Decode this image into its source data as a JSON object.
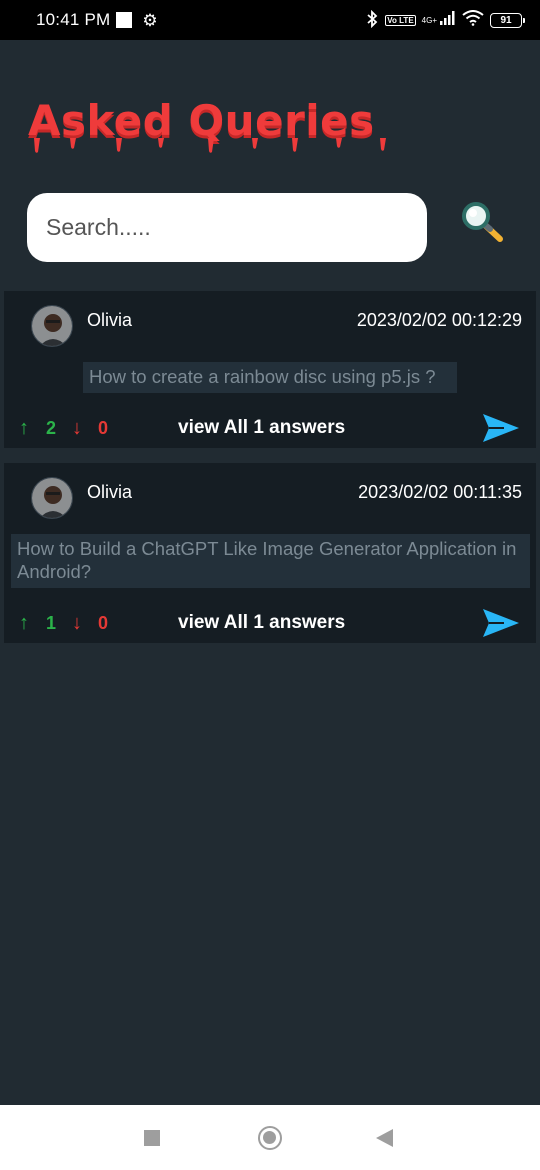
{
  "status_bar": {
    "time": "10:41 PM",
    "network_label": "4G+",
    "volte_label": "Vo LTE",
    "battery": "91"
  },
  "header": {
    "title": "Asked Queries"
  },
  "search": {
    "placeholder": "Search....."
  },
  "queries": [
    {
      "user": "Olivia",
      "timestamp": "2023/02/02 00:12:29",
      "question": "How to create a rainbow disc using p5.js ?",
      "upvotes": "2",
      "downvotes": "0",
      "view_answers": "view All 1 answers"
    },
    {
      "user": "Olivia",
      "timestamp": "2023/02/02 00:11:35",
      "question": "How to Build a ChatGPT Like Image Generator Application in Android?",
      "upvotes": "1",
      "downvotes": "0",
      "view_answers": "view All 1 answers"
    }
  ],
  "icons": {
    "up": "up-arrow-icon",
    "down": "down-arrow-icon",
    "send": "send-icon",
    "search": "magnifier-icon",
    "settings": "gear-icon",
    "bluetooth": "bluetooth-icon",
    "wifi": "wifi-icon"
  },
  "colors": {
    "background": "#212b32",
    "card": "#151d23",
    "title_red": "#ef3b3b",
    "upvote_green": "#2bb34a",
    "downvote_red": "#e53935",
    "send_blue": "#29b6f6"
  }
}
